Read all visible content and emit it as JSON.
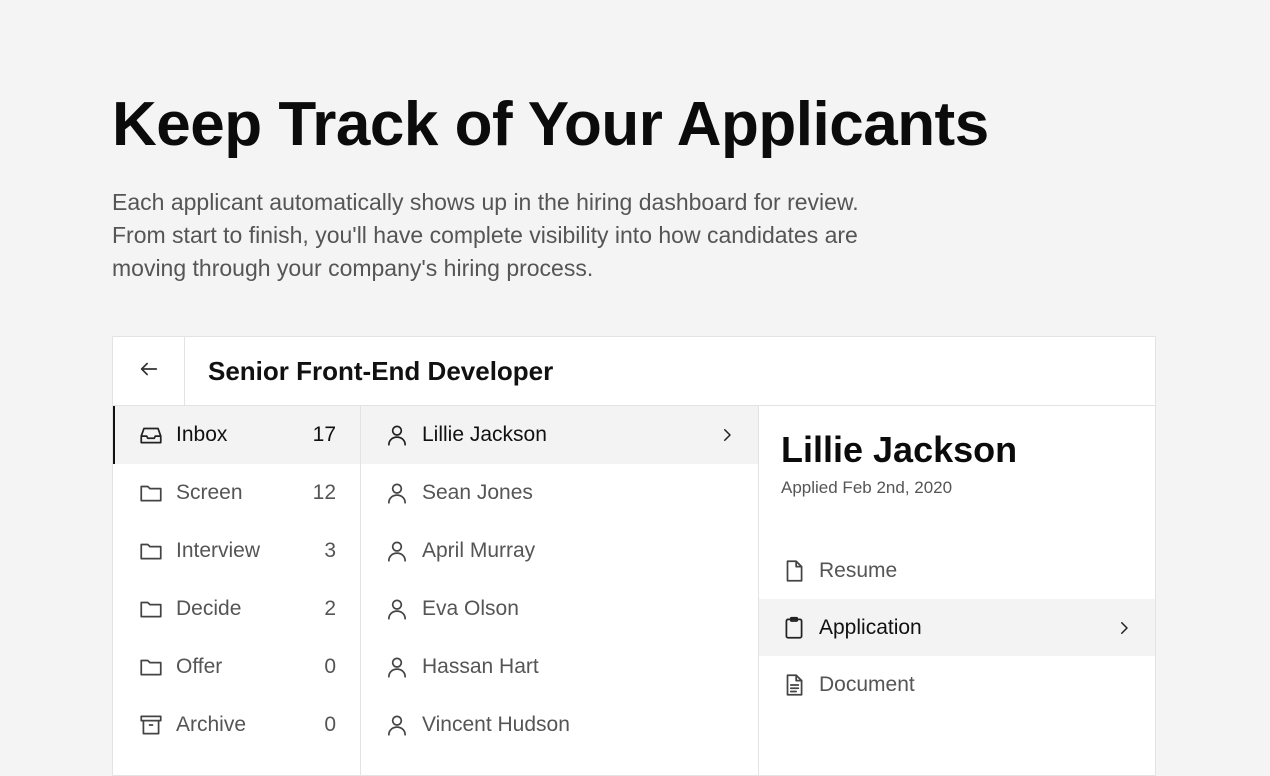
{
  "hero": {
    "title": "Keep Track of Your Applicants",
    "lines": [
      "Each applicant automatically shows up in the hiring dashboard for review.",
      "From start to finish, you'll have complete visibility into how candidates are",
      "moving through your company's hiring process."
    ]
  },
  "panel": {
    "job_title": "Senior Front-End Developer",
    "folders": [
      {
        "label": "Inbox",
        "count": "17",
        "icon": "inbox-icon"
      },
      {
        "label": "Screen",
        "count": "12",
        "icon": "folder-icon"
      },
      {
        "label": "Interview",
        "count": "3",
        "icon": "folder-icon"
      },
      {
        "label": "Decide",
        "count": "2",
        "icon": "folder-icon"
      },
      {
        "label": "Offer",
        "count": "0",
        "icon": "folder-icon"
      },
      {
        "label": "Archive",
        "count": "0",
        "icon": "archive-icon"
      }
    ],
    "applicants": [
      {
        "name": "Lillie Jackson"
      },
      {
        "name": "Sean Jones"
      },
      {
        "name": "April Murray"
      },
      {
        "name": "Eva Olson"
      },
      {
        "name": "Hassan Hart"
      },
      {
        "name": "Vincent Hudson"
      }
    ],
    "detail": {
      "name": "Lillie Jackson",
      "applied": "Applied Feb 2nd, 2020",
      "items": [
        {
          "label": "Resume",
          "icon": "file-icon"
        },
        {
          "label": "Application",
          "icon": "clipboard-icon"
        },
        {
          "label": "Document",
          "icon": "document-icon"
        }
      ]
    }
  },
  "colors": {
    "background": "#f4f4f4",
    "panel": "#ffffff",
    "active_row": "#f3f3f3",
    "text_primary": "#111111",
    "text_secondary": "#555555"
  }
}
